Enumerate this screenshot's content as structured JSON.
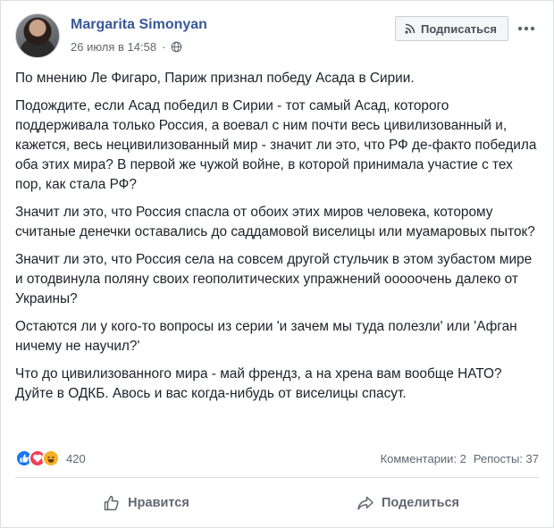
{
  "post": {
    "author": "Margarita Simonyan",
    "timestamp": "26 июля в 14:58",
    "subscribe_label": "Подписаться",
    "paragraphs": [
      "По мнению Ле Фигаро, Париж признал победу Асада в Сирии.",
      "Подождите, если Асад победил в Сирии - тот самый Асад, которого поддерживала только Россия, а воевал с ним почти весь цивилизованный и, кажется, весь нецивилизованный мир - значит ли это, что РФ де-факто победила оба этих мира? В первой же чужой войне, в которой принимала участие с тех пор, как стала РФ?",
      "Значит ли это, что Россия спасла от обоих этих миров человека, которому считаные денечки оставались до саддамовой виселицы или муамаровых пыток?",
      "Значит ли это, что Россия села на совсем другой стульчик в этом зубастом мире и отодвинула поляну своих геополитических упражнений ооооочень далеко от Украины?",
      "Остаются ли у кого-то вопросы из серии 'и зачем мы туда полезли' или 'Афган ничему не научил?'",
      "Что до цивилизованного мира - май френдз, а на хрена вам вообще НАТО? Дуйте в ОДКБ. Авось и вас когда-нибудь от виселицы спасут."
    ]
  },
  "stats": {
    "reaction_count": "420",
    "comments": "Комментарии: 2",
    "reposts": "Репосты: 37"
  },
  "actions": {
    "like_label": "Нравится",
    "share_label": "Поделиться"
  },
  "colors": {
    "link": "#385898",
    "like": "#1877f2",
    "love": "#f33e58",
    "haha": "#f7b125",
    "muted": "#606770"
  },
  "icons": [
    "globe-icon",
    "rss-icon",
    "more-icon",
    "like-reaction-icon",
    "love-reaction-icon",
    "haha-reaction-icon",
    "thumbs-up-icon",
    "share-arrow-icon"
  ]
}
